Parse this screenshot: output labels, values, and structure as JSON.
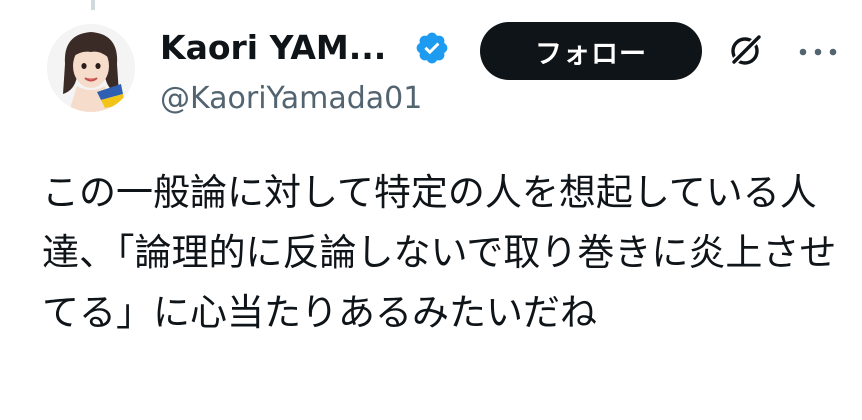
{
  "author": {
    "display_name": "Kaori YAM...",
    "handle": "@KaoriYamada01",
    "verified": true,
    "avatar": "avatar-illustration",
    "verified_color": "#1d9bf0"
  },
  "actions": {
    "follow_label": "フォロー",
    "grok_icon": "grok-icon",
    "more_icon": "more-icon"
  },
  "post": {
    "text": "この一般論に対して特定の人を想起している人達、「論理的に反論しないで取り巻きに炎上させてる」に心当たりあるみたいだね"
  }
}
